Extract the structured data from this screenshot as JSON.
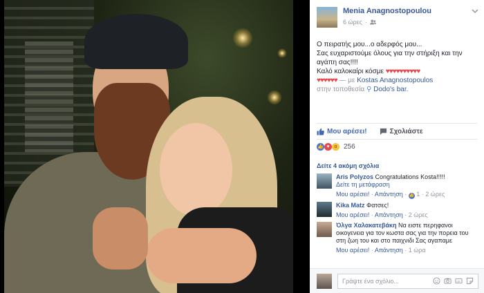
{
  "post": {
    "author": "Menia Anagnostopoulou",
    "time": "6 ώρες",
    "line1": "Ο πειρατής μου...ο αδερφός μου...",
    "line2": "Σας ευχαριστούμε όλους για την στήριξη και την αγάπη σας!!!!",
    "line3": "Καλό καλοκαίρι κόσμε",
    "hearts_a": "♥♥♥♥♥♥♥♥♥♥",
    "hearts_b": "♥♥♥♥♥♥",
    "with_text": "— με",
    "with_name": "Kostas Anagnostopoulos",
    "at_text": "στην τοποθεσία",
    "place": "Dodo's bar."
  },
  "actions": {
    "like": "Μου αρέσει!",
    "comment": "Σχολιάστε"
  },
  "reactions": {
    "count": "256"
  },
  "more_comments": "Δείτε 4 ακόμη σχόλια",
  "comments": [
    {
      "name": "Aris Polyzos",
      "text": "Congratulations Kosta!!!!!",
      "translate": "Δείτε τη μετάφραση",
      "like": "Μου αρέσει!",
      "reply": "Απάντηση",
      "likes": "1",
      "time": "2 ώρες"
    },
    {
      "name": "Kika Matz",
      "text": "Φατσες!",
      "like": "Μου αρέσει!",
      "reply": "Απάντηση",
      "time": "2 ώρες"
    },
    {
      "name": "Όλγα Χαλακατεβάκη",
      "text": "Να ειστε περηφανοι οικογενεια για τον κωστα σας για την πορεια του στη ζωη του και στο παιχνιδι Σας αγαπαμε",
      "like": "Μου αρέσει!",
      "reply": "Απάντηση",
      "time": "1 ώρα"
    }
  ],
  "composer": {
    "placeholder": "Γράψτε ένα σχόλιο..."
  },
  "colors": {
    "link": "#365899",
    "heart": "#e8474d",
    "like_blue": "#4267b2"
  }
}
